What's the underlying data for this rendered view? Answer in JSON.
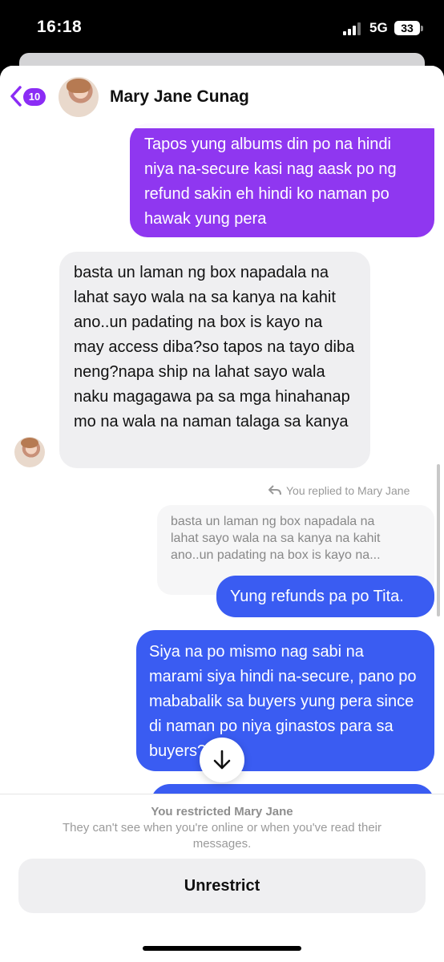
{
  "status_bar": {
    "time": "16:18",
    "network": "5G",
    "battery": "33"
  },
  "header": {
    "back_badge": "10",
    "contact_name": "Mary Jane Cunag"
  },
  "messages": {
    "out_1": "Tapos yung albums din po na hindi niya na-secure kasi nag aask po ng refund sakin eh hindi ko naman po hawak yung pera",
    "in_1": "basta un laman ng box napadala na lahat sayo wala na sa kanya na kahit ano..un padating na box is kayo na may access diba?so tapos na tayo diba neng?napa ship na lahat sayo wala naku magagawa pa sa mga hinahanap mo na wala na naman talaga sa kanya",
    "replied_label": "You replied to Mary Jane",
    "quote": "basta un laman ng box napadala na\nlahat sayo wala na sa kanya na kahit\nano..un padating na box is kayo na...",
    "out_2": "Yung refunds pa po Tita.",
    "out_3": "Siya na po mismo nag sabi na marami siya hindi na-secure, pano po mababalik sa buyers yung pera since di naman po niya ginastos para sa buyers?"
  },
  "footer": {
    "restricted_title": "You restricted Mary Jane",
    "restricted_desc": "They can't see when you're online or when you've read their messages.",
    "unrestrict_label": "Unrestrict"
  },
  "colors": {
    "purple_bubble": "#8f37f0",
    "blue_bubble": "#3a5cf2",
    "incoming_bubble": "#efeff1",
    "badge": "#8b2cf5"
  }
}
